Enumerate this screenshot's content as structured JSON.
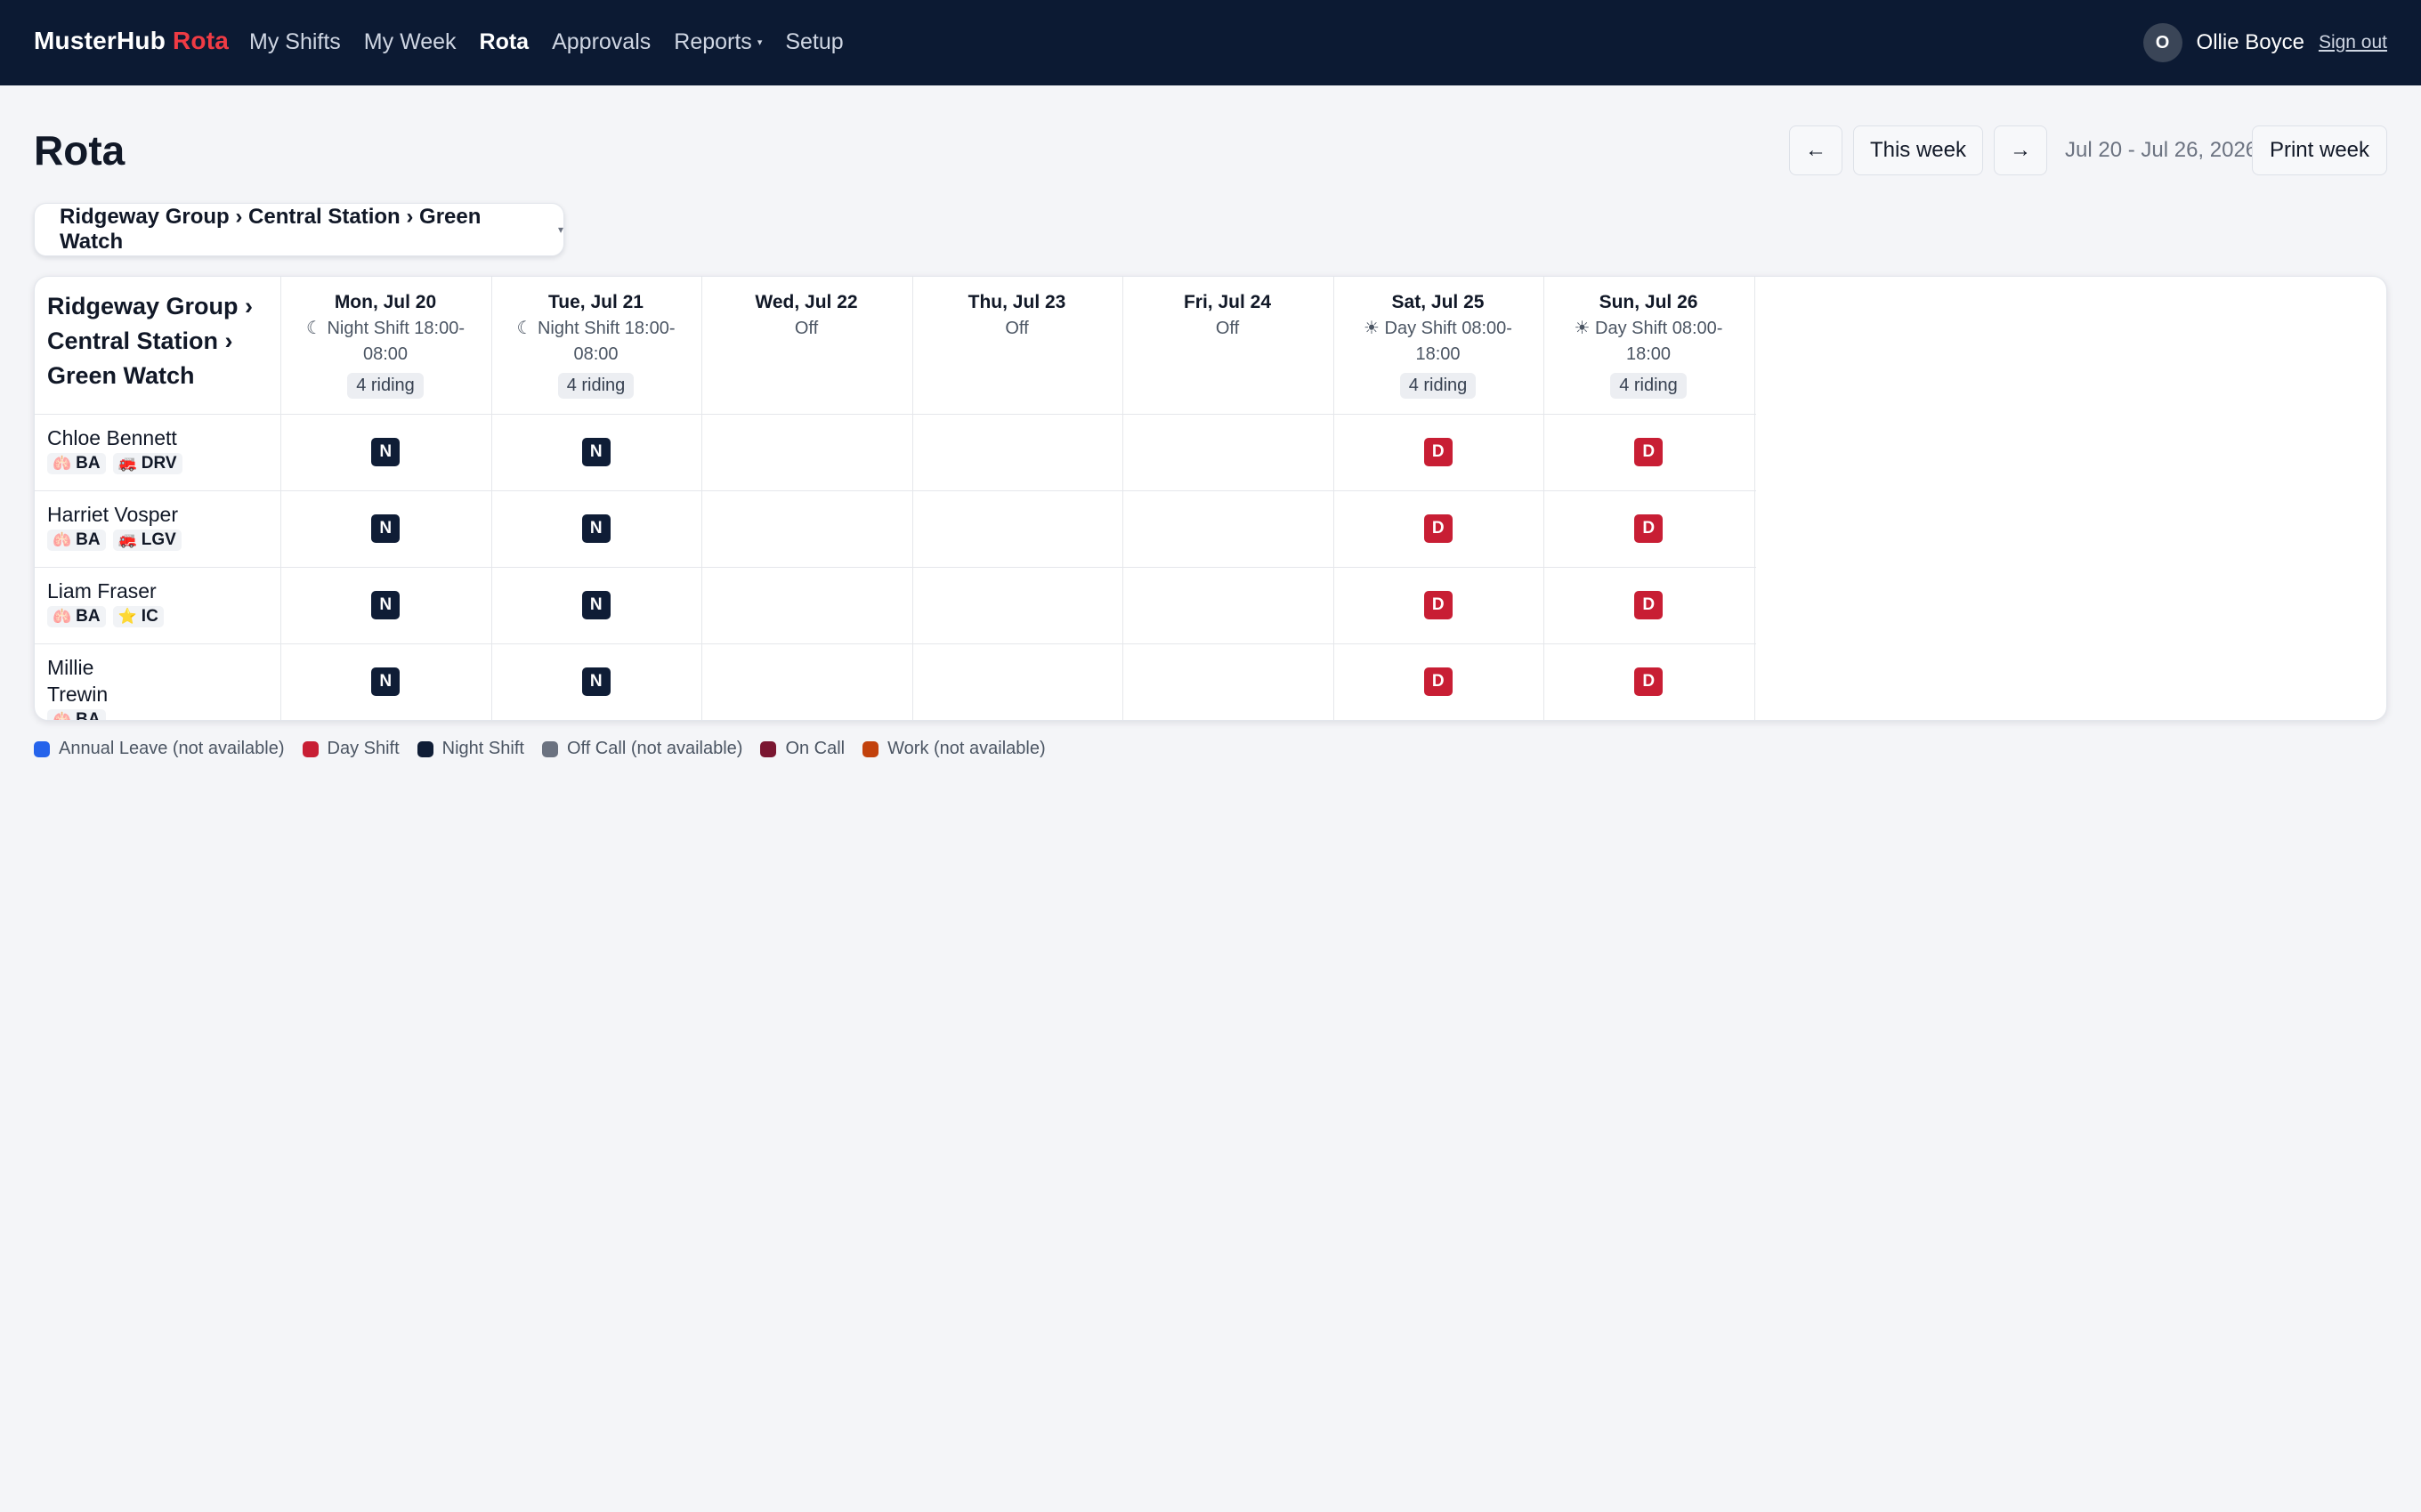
{
  "brand": {
    "name": "MusterHub",
    "accent": "Rota"
  },
  "nav": [
    {
      "label": "My Shifts",
      "active": false
    },
    {
      "label": "My Week",
      "active": false
    },
    {
      "label": "Rota",
      "active": true
    },
    {
      "label": "Approvals",
      "active": false
    },
    {
      "label": "Reports",
      "active": false,
      "dropdown": true
    },
    {
      "label": "Setup",
      "active": false
    }
  ],
  "user": {
    "initial": "O",
    "name": "Ollie Boyce",
    "sign_out": "Sign out"
  },
  "page": {
    "title": "Rota"
  },
  "toolbar": {
    "prev_icon": "←",
    "this_week": "This week",
    "next_icon": "→",
    "date_range": "Jul 20 - Jul 26, 2026",
    "print_week": "Print week"
  },
  "unit_selector": {
    "value": "Ridgeway Group › Central Station › Green Watch"
  },
  "grid": {
    "corner_title": "Ridgeway Group › Central Station › Green Watch",
    "days": [
      {
        "name": "Mon, Jul 20",
        "shift_icon": "moon-icon",
        "shift": "Night Shift 18:00-08:00",
        "riding": "4 riding"
      },
      {
        "name": "Tue, Jul 21",
        "shift_icon": "moon-icon",
        "shift": "Night Shift 18:00-08:00",
        "riding": "4 riding"
      },
      {
        "name": "Wed, Jul 22",
        "shift_icon": "",
        "shift": "Off",
        "riding": ""
      },
      {
        "name": "Thu, Jul 23",
        "shift_icon": "",
        "shift": "Off",
        "riding": ""
      },
      {
        "name": "Fri, Jul 24",
        "shift_icon": "",
        "shift": "Off",
        "riding": ""
      },
      {
        "name": "Sat, Jul 25",
        "shift_icon": "sun-icon",
        "shift": "Day Shift 08:00-18:00",
        "riding": "4 riding"
      },
      {
        "name": "Sun, Jul 26",
        "shift_icon": "sun-icon",
        "shift": "Day Shift 08:00-18:00",
        "riding": "4 riding"
      }
    ],
    "people": [
      {
        "name": "Chloe Bennett",
        "skills": [
          {
            "icon": "lungs-icon",
            "code": "BA"
          },
          {
            "icon": "fire-engine-icon",
            "code": "DRV"
          }
        ],
        "shifts": [
          "N",
          "N",
          "",
          "",
          "",
          "D",
          "D"
        ]
      },
      {
        "name": "Harriet Vosper",
        "skills": [
          {
            "icon": "lungs-icon",
            "code": "BA"
          },
          {
            "icon": "fire-engine-icon",
            "code": "LGV"
          }
        ],
        "shifts": [
          "N",
          "N",
          "",
          "",
          "",
          "D",
          "D"
        ]
      },
      {
        "name": "Liam Fraser",
        "skills": [
          {
            "icon": "lungs-icon",
            "code": "BA"
          },
          {
            "icon": "star-icon",
            "code": "IC"
          }
        ],
        "shifts": [
          "N",
          "N",
          "",
          "",
          "",
          "D",
          "D"
        ]
      },
      {
        "name": "Millie Trewin",
        "skills": [
          {
            "icon": "lungs-icon",
            "code": "BA"
          }
        ],
        "shifts": [
          "N",
          "N",
          "",
          "",
          "",
          "D",
          "D"
        ]
      }
    ]
  },
  "legend": [
    {
      "label": "Annual Leave (not available)",
      "color": "#2563eb"
    },
    {
      "label": "Day Shift",
      "color": "#c81e34"
    },
    {
      "label": "Night Shift",
      "color": "#0f1d36"
    },
    {
      "label": "Off Call (not available)",
      "color": "#6b7280"
    },
    {
      "label": "On Call",
      "color": "#7a1631"
    },
    {
      "label": "Work (not available)",
      "color": "#c2410c"
    }
  ],
  "colors": {
    "nav_bg": "#0c1a33",
    "brand_accent": "#ef3b44",
    "day_shift": "#c81e34",
    "night_shift": "#0f1d36"
  }
}
